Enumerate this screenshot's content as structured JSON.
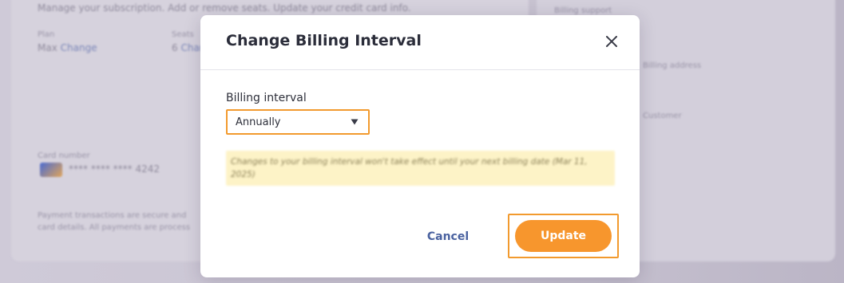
{
  "background": {
    "subtitle": "Manage your subscription. Add or remove seats. Update your credit card info.",
    "plan_label": "Plan",
    "plan_value": "Max",
    "plan_change": "Change",
    "seats_label": "Seats",
    "seats_value": "6",
    "seats_change": "Change",
    "card_label": "Card number",
    "card_number": "**** **** **** 4242",
    "security_note_line1": "Payment transactions are secure and",
    "security_note_line2": "card details. All payments are process",
    "right_heading": "Billing support",
    "right_line1": "Billing address",
    "right_link": "Customer"
  },
  "modal": {
    "title": "Change Billing Interval",
    "field_label": "Billing interval",
    "selected_interval": "Annually",
    "notice": "Changes to your billing interval won't take effect until your next billing date (Mar 11, 2025)",
    "cancel_label": "Cancel",
    "update_label": "Update"
  },
  "colors": {
    "accent": "#f7962d",
    "highlight_border": "#f29a2e",
    "link": "#4a62a0",
    "notice_bg": "#fdf3c7"
  },
  "icons": {
    "close": "close-icon",
    "dropdown": "caret-down-icon",
    "card": "credit-card-icon"
  }
}
